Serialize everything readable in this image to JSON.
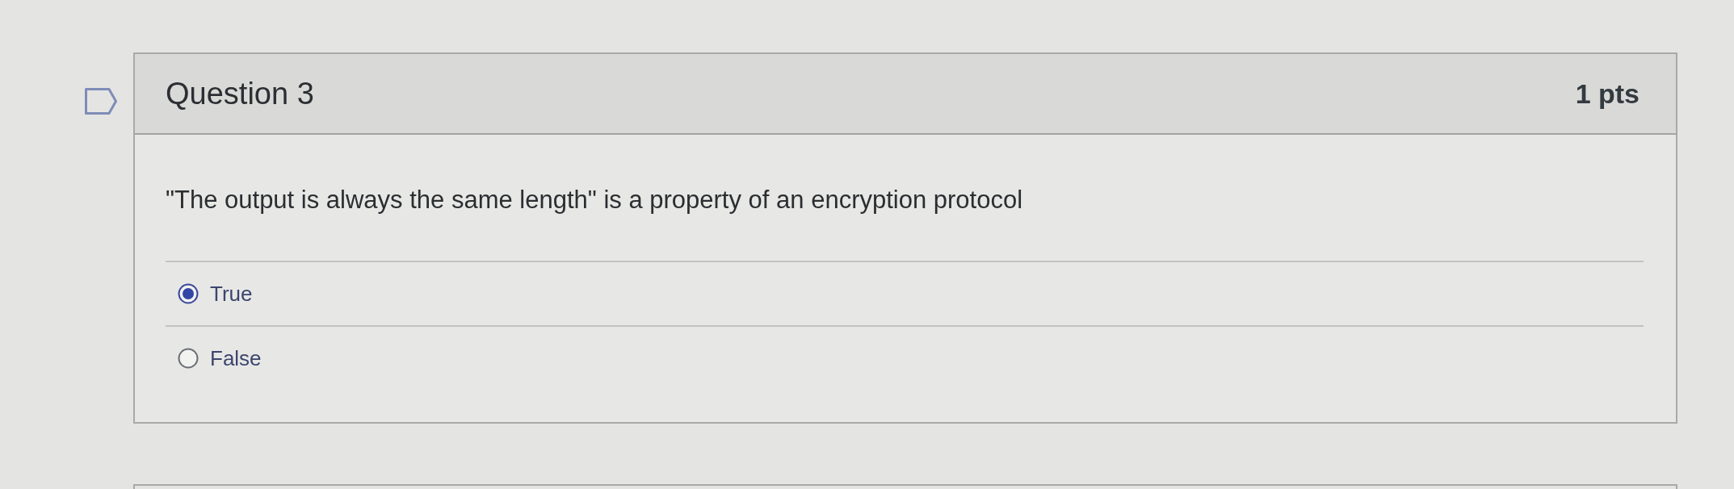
{
  "question": {
    "flagged": false,
    "title": "Question 3",
    "points": "1 pts",
    "text": "\"The output is always the same length\" is a property of an encryption protocol",
    "answers": [
      {
        "label": "True",
        "selected": true
      },
      {
        "label": "False",
        "selected": false
      }
    ]
  }
}
